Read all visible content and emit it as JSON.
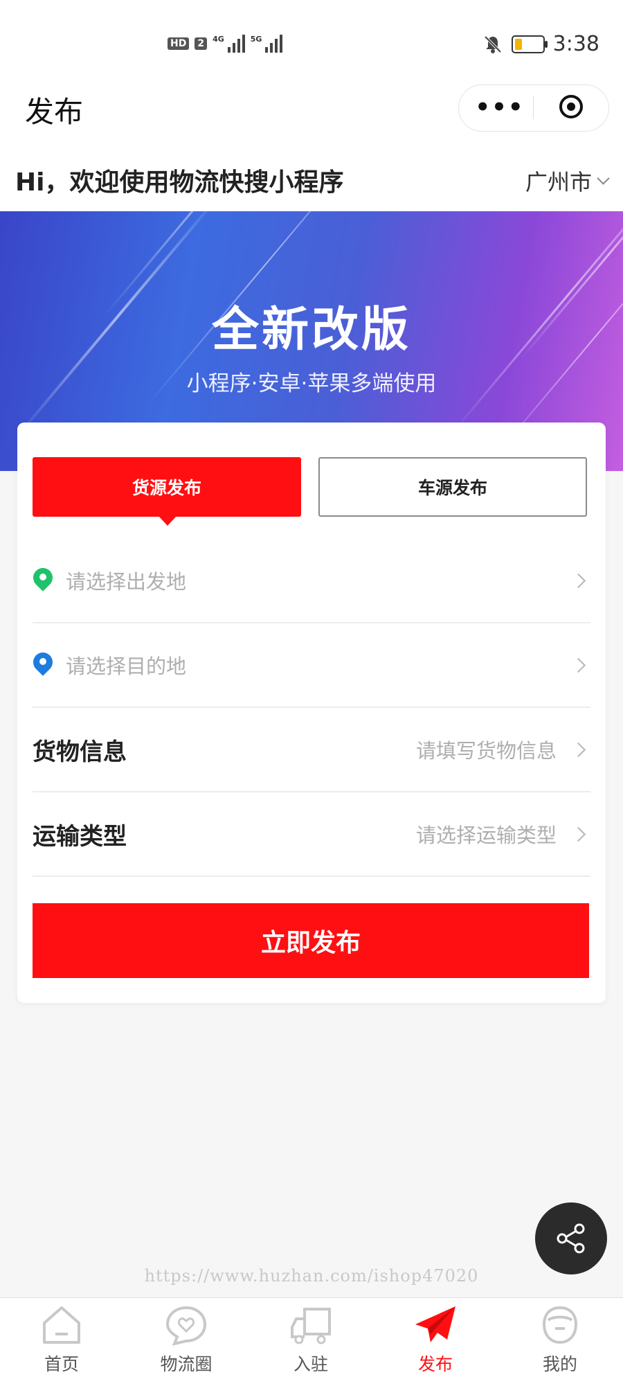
{
  "status_bar": {
    "hd_badge": "HD",
    "sim_badge": "2",
    "net1": "4G",
    "net2": "5G",
    "time": "3:38",
    "battery_level": 0.25,
    "battery_color": "#f4b400"
  },
  "nav": {
    "title": "发布",
    "more_label": "•••"
  },
  "header": {
    "greeting": "Hi，欢迎使用物流快搜小程序",
    "city": "广州市"
  },
  "banner": {
    "title": "全新改版",
    "subtitle": "小程序·安卓·苹果多端使用"
  },
  "form": {
    "tabs": [
      {
        "label": "货源发布",
        "active": true
      },
      {
        "label": "车源发布",
        "active": false
      }
    ],
    "origin_placeholder": "请选择出发地",
    "destination_placeholder": "请选择目的地",
    "cargo_label": "货物信息",
    "cargo_placeholder": "请填写货物信息",
    "transport_label": "运输类型",
    "transport_placeholder": "请选择运输类型",
    "submit_label": "立即发布"
  },
  "watermark": "https://www.huzhan.com/ishop47020",
  "tabbar": {
    "items": [
      {
        "label": "首页",
        "icon": "home-icon",
        "active": false
      },
      {
        "label": "物流圈",
        "icon": "heart-chat-icon",
        "active": false
      },
      {
        "label": "入驻",
        "icon": "truck-icon",
        "active": false
      },
      {
        "label": "发布",
        "icon": "paper-plane-icon",
        "active": true
      },
      {
        "label": "我的",
        "icon": "user-face-icon",
        "active": false
      }
    ]
  },
  "colors": {
    "accent": "#ff0f12",
    "origin_pin": "#1ec26b",
    "destination_pin": "#1e7be0"
  }
}
